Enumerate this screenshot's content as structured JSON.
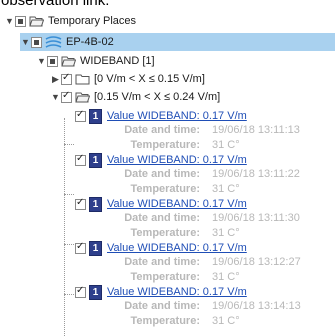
{
  "caption": "observation link.",
  "tree": {
    "root": {
      "label": "Temporary Places"
    },
    "site": {
      "label": "EP-4B-02"
    },
    "band": {
      "label": "WIDEBAND [1]"
    },
    "range_low": {
      "label": "[0 V/m < X ≤ 0.15 V/m]"
    },
    "range_high": {
      "label": "[0.15 V/m < X ≤ 0.24 V/m]"
    },
    "measurements": [
      {
        "badge": "1",
        "title": "Value WIDEBAND: 0.17 V/m",
        "date_label": "Date and time:",
        "date_value": "19/06/18 13:11:13",
        "temp_label": "Temperature:",
        "temp_value": "31 C°"
      },
      {
        "badge": "1",
        "title": "Value WIDEBAND: 0.17 V/m",
        "date_label": "Date and time:",
        "date_value": "19/06/18 13:11:22",
        "temp_label": "Temperature:",
        "temp_value": "31 C°"
      },
      {
        "badge": "1",
        "title": "Value WIDEBAND: 0.17 V/m",
        "date_label": "Date and time:",
        "date_value": "19/06/18 13:11:30",
        "temp_label": "Temperature:",
        "temp_value": "31 C°"
      },
      {
        "badge": "1",
        "title": "Value WIDEBAND: 0.17 V/m",
        "date_label": "Date and time:",
        "date_value": "19/06/18 13:12:27",
        "temp_label": "Temperature:",
        "temp_value": "31 C°"
      },
      {
        "badge": "1",
        "title": "Value WIDEBAND: 0.17 V/m",
        "date_label": "Date and time:",
        "date_value": "19/06/18 13:14:13",
        "temp_label": "Temperature:",
        "temp_value": "31 C°"
      }
    ]
  },
  "icons": {
    "folder": "folder-icon",
    "open_folder": "open-folder-icon",
    "sensor": "sensor-icon"
  },
  "colors": {
    "selection": "#a9d1ef",
    "link": "#1f4eb6",
    "badge": "#2e3f8c",
    "meta_text": "#b8b8b8"
  }
}
